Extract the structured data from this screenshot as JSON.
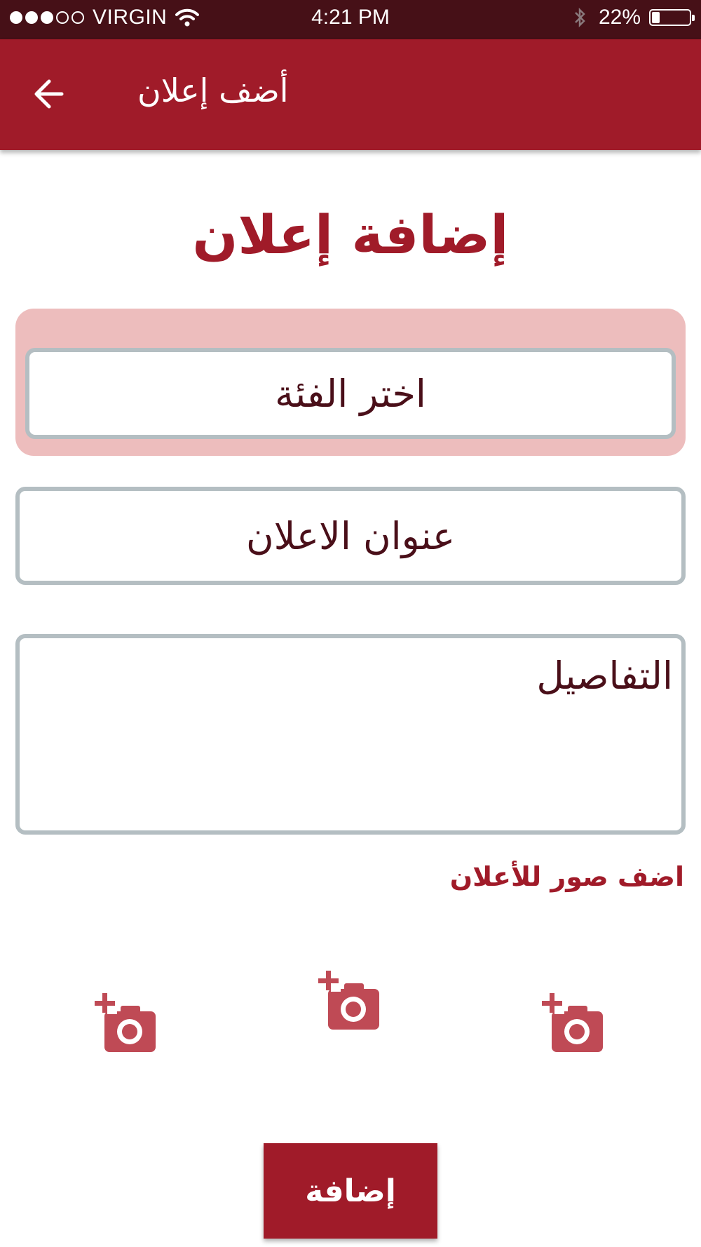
{
  "status_bar": {
    "signal_filled": 3,
    "signal_total": 5,
    "carrier": "VIRGIN",
    "time": "4:21 PM",
    "battery_text": "22%",
    "battery_level": 0.22
  },
  "header": {
    "title": "أضف إعلان",
    "back_icon": "arrow-left-icon"
  },
  "form": {
    "heading": "إضافة إعلان",
    "category_placeholder": "اختر الفئة",
    "title_placeholder": "عنوان الاعلان",
    "details_placeholder": "التفاصيل",
    "photos_label": "اضف صور للأعلان",
    "photo_icon": "add-photo-camera-icon",
    "submit_label": "إضافة"
  },
  "colors": {
    "status_bar": "#461017",
    "primary": "#a01b29",
    "category_highlight": "#edbdbd",
    "field_border": "#b4bec2",
    "field_text": "#4a0f19",
    "camera_icon": "#bf4a55"
  }
}
